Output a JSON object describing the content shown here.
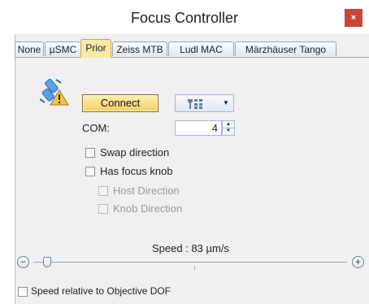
{
  "window": {
    "title": "Focus Controller",
    "close_symbol": "×"
  },
  "tabs": [
    {
      "label": "None"
    },
    {
      "label": "µSMC"
    },
    {
      "label": "Prior",
      "active": true
    },
    {
      "label": "Zeiss MTB"
    },
    {
      "label": "Ludl MAC"
    },
    {
      "label": "Märzhäuser Tango"
    }
  ],
  "panel": {
    "connection_icon": "disconnected-plug-warning-icon",
    "connect_label": "Connect",
    "settings_dropdown_icon": "wrench-settings-icon",
    "com_label": "COM:",
    "com_value": "4",
    "swap_direction_label": "Swap direction",
    "swap_direction_checked": false,
    "has_focus_knob_label": "Has focus knob",
    "has_focus_knob_checked": false,
    "host_direction_label": "Host Direction",
    "host_direction_checked": false,
    "knob_direction_label": "Knob Direction",
    "knob_direction_checked": false,
    "speed_label": "Speed : 83 µm/s",
    "speed_slider_position": 0.04,
    "minus_symbol": "−",
    "plus_symbol": "+",
    "speed_relative_label": "Speed relative to Objective DOF",
    "speed_relative_checked": false
  },
  "colors": {
    "active_tab": "#fbe8a6",
    "connect_button": "#f8cc5f",
    "close_button": "#c7453a",
    "panel_background": "#f0f0f0"
  }
}
